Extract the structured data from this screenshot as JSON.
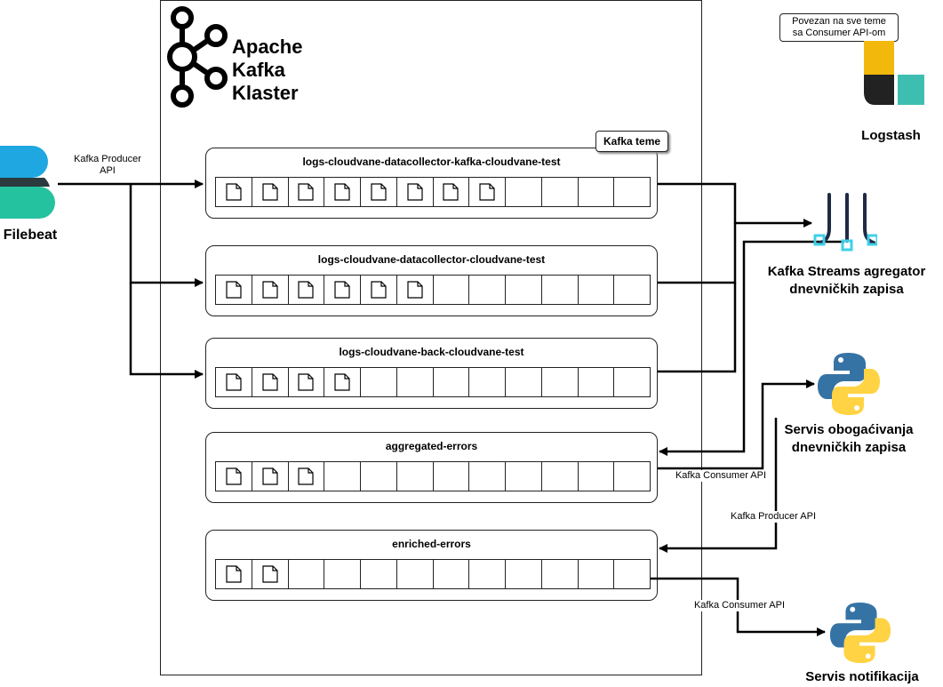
{
  "cluster": {
    "title_lines": [
      "Apache",
      "Kafka",
      "Klaster"
    ]
  },
  "badge": {
    "topics_label": "Kafka teme"
  },
  "topics": [
    {
      "name": "logs-cloudvane-datacollector-kafka-cloudvane-test",
      "filled": [
        true,
        true,
        true,
        true,
        true,
        true,
        true,
        true,
        false,
        false,
        false,
        false
      ]
    },
    {
      "name": "logs-cloudvane-datacollector-cloudvane-test",
      "filled": [
        true,
        true,
        true,
        true,
        true,
        true,
        false,
        false,
        false,
        false,
        false,
        false
      ]
    },
    {
      "name": "logs-cloudvane-back-cloudvane-test",
      "filled": [
        true,
        true,
        true,
        true,
        false,
        false,
        false,
        false,
        false,
        false,
        false,
        false
      ]
    },
    {
      "name": "aggregated-errors",
      "filled": [
        true,
        true,
        true,
        false,
        false,
        false,
        false,
        false,
        false,
        false,
        false,
        false
      ]
    },
    {
      "name": "enriched-errors",
      "filled": [
        true,
        true,
        false,
        false,
        false,
        false,
        false,
        false,
        false,
        false,
        false,
        false
      ]
    }
  ],
  "nodes": {
    "filebeat": "Filebeat",
    "logstash": "Logstash",
    "streams_line1": "Kafka Streams agregator",
    "streams_line2": "dnevničkih zapisa",
    "enrich_line1": "Servis obogaćivanja",
    "enrich_line2": "dnevničkih zapisa",
    "notify": "Servis notifikacija"
  },
  "edge_labels": {
    "producer_line1": "Kafka Producer",
    "producer_line2": "API",
    "consumer_1": "Kafka Consumer API",
    "producer_2": "Kafka Producer API",
    "consumer_2": "Kafka Consumer API"
  },
  "note": {
    "line1": "Povezan na sve teme",
    "line2": "sa Consumer API-om"
  },
  "colors": {
    "line": "#000000",
    "filebeat_top": "#1ea7e0",
    "filebeat_mid": "#2b3a3f",
    "filebeat_bottom": "#25c2a0",
    "logstash_yellow": "#f2b80c",
    "logstash_dark": "#222222",
    "logstash_teal": "#3ebeb0",
    "python_blue": "#3673a5",
    "python_yellow": "#ffd343",
    "streams_navy": "#1f2a44",
    "streams_cyan": "#3fd0e8"
  }
}
